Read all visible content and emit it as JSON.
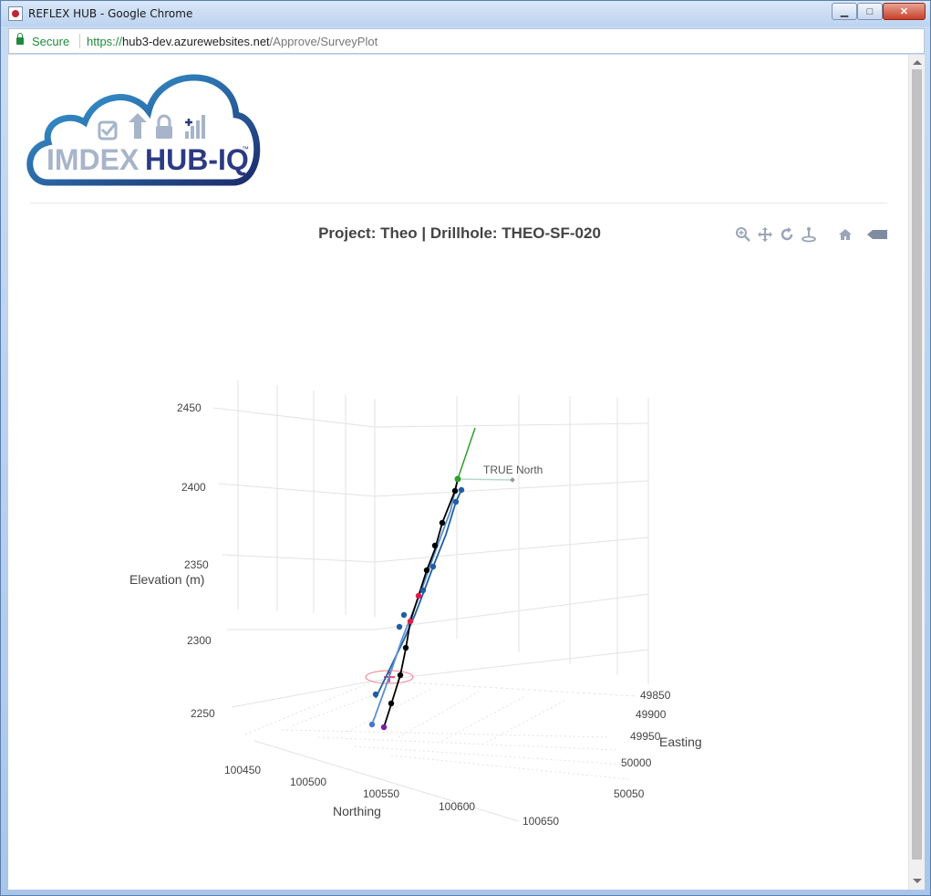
{
  "window": {
    "title": "REFLEX HUB - Google Chrome",
    "minimize_label": "▁",
    "maximize_label": "□",
    "close_label": "✕"
  },
  "address": {
    "secure_label": "Secure",
    "url_scheme": "https://",
    "url_host": "hub3-dev.azurewebsites.net",
    "url_path": "/Approve/SurveyPlot"
  },
  "logo": {
    "brand_text": "IMDEX",
    "product_text": "HUB-IQ",
    "trademark": "™"
  },
  "plot": {
    "title": "Project: Theo | Drillhole: THEO-SF-020",
    "annotation": "TRUE North",
    "modebar": [
      "zoom-icon",
      "pan-icon",
      "orbit-rotate-icon",
      "turntable-rotate-icon",
      "reset-camera-icon",
      "camera-icon"
    ]
  },
  "chart_data": {
    "type": "scatter3d",
    "title": "Project: Theo | Drillhole: THEO-SF-020",
    "axes": {
      "elevation": {
        "label": "Elevation (m)",
        "ticks": [
          "2250",
          "2300",
          "2350",
          "2400",
          "2450"
        ]
      },
      "northing": {
        "label": "Northing",
        "ticks": [
          "100450",
          "100500",
          "100550",
          "100600",
          "100650"
        ]
      },
      "easting": {
        "label": "Easting",
        "ticks": [
          "49850",
          "49900",
          "49950",
          "50000",
          "50050"
        ]
      }
    },
    "annotations": [
      "TRUE North"
    ],
    "series_colors": {
      "trace_black": "#000000",
      "trace_blue": "#1f5fa0",
      "collar": "#2ca02c",
      "red_marker": "#e31a4a",
      "end_marker": "#7b1fa2",
      "north_line": "#7fbf7f"
    }
  }
}
